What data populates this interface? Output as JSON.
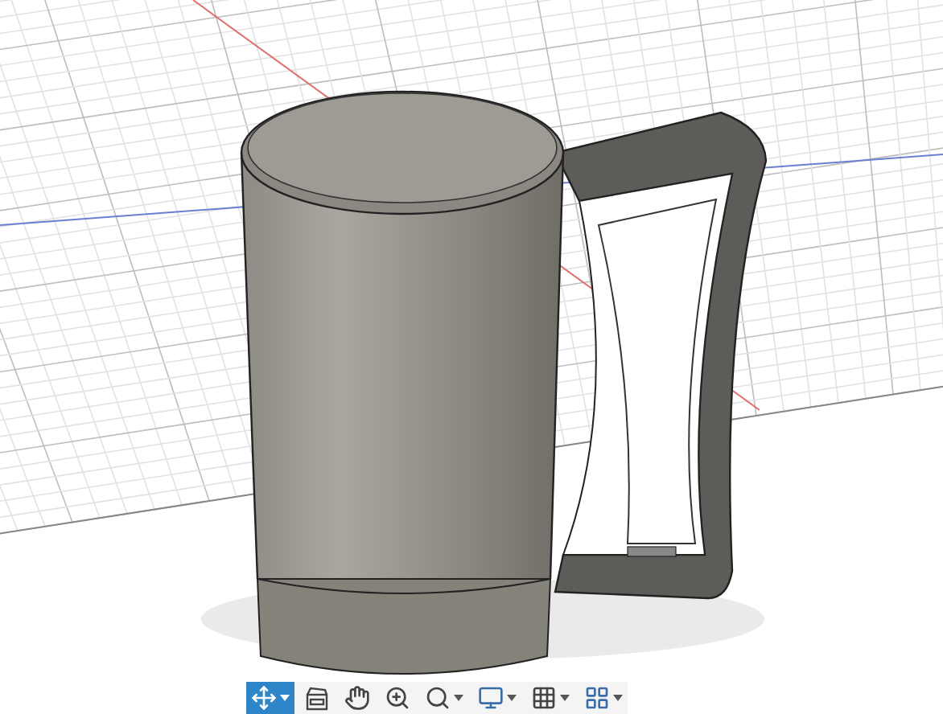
{
  "toolbar": {
    "tools": [
      {
        "kind": "orbit",
        "selected": true,
        "dropdown": true
      },
      {
        "kind": "look",
        "selected": false,
        "dropdown": false
      },
      {
        "kind": "pan",
        "selected": false,
        "dropdown": false
      },
      {
        "kind": "zoom",
        "selected": false,
        "dropdown": false
      },
      {
        "kind": "fit",
        "selected": false,
        "dropdown": true
      },
      {
        "kind": "display",
        "selected": false,
        "dropdown": true
      },
      {
        "kind": "grid",
        "selected": false,
        "dropdown": true
      },
      {
        "kind": "viewports",
        "selected": false,
        "dropdown": true
      }
    ]
  }
}
